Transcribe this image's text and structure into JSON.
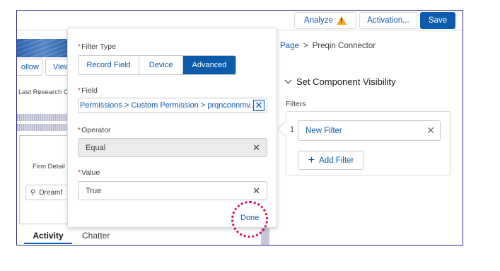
{
  "toolbar": {
    "analyze_label": "Analyze",
    "activation_label": "Activation...",
    "save_label": "Save",
    "warning_color": "#f4a31c"
  },
  "background": {
    "follow_label": "ollow",
    "view_label": "View",
    "last_research_text": "Last Research Co",
    "firm_detail_text": "Firm Detail",
    "search_text": "Dreamf",
    "tabs": [
      {
        "label": "Activity",
        "active": true
      },
      {
        "label": "Chatter",
        "active": false
      }
    ]
  },
  "panel": {
    "breadcrumb": {
      "link": "Page",
      "separator": ">",
      "current": "Preqin Connector"
    },
    "section_title": "Set Component Visibility",
    "filters_label": "Filters",
    "filter_number": "1",
    "filter_item_label": "New Filter",
    "add_filter_label": "Add Filter"
  },
  "popover": {
    "filter_type_label": "Filter Type",
    "filter_types": [
      "Record Field",
      "Device",
      "Advanced"
    ],
    "selected_filter_type": "Advanced",
    "field_label": "Field",
    "field_value": "Permissions > Custom Permission > prqnconnmv...",
    "operator_label": "Operator",
    "operator_value": "Equal",
    "value_label": "Value",
    "value_value": "True",
    "done_label": "Done",
    "required_marker": "*"
  },
  "colors": {
    "brand_blue": "#0b5cab",
    "highlight_circle": "#c8106b"
  }
}
